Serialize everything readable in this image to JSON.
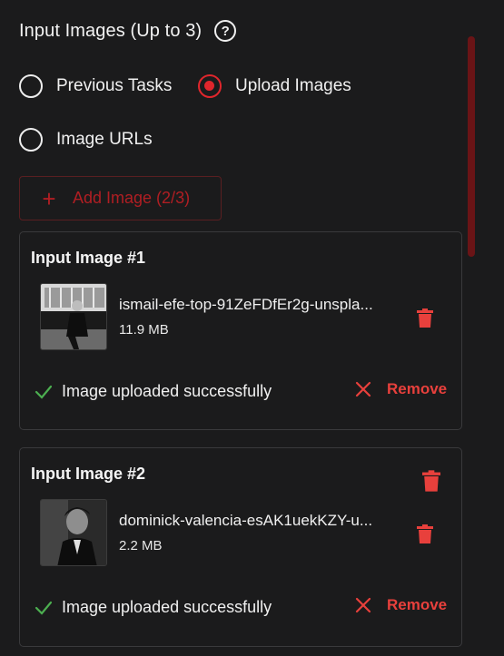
{
  "section": {
    "title": "Input Images (Up to 3)",
    "help_icon": "help-circle-icon"
  },
  "source_options": [
    {
      "label": "Previous Tasks",
      "checked": false
    },
    {
      "label": "Upload Images",
      "checked": true
    },
    {
      "label": "Image URLs",
      "checked": false
    }
  ],
  "add_button": {
    "label": "Add Image (2/3)",
    "icon": "plus-icon"
  },
  "images": [
    {
      "title": "Input Image #1",
      "file_name": "ismail-efe-top-91ZeFDfEr2g-unspla...",
      "file_size": "11.9 MB",
      "status": "Image uploaded successfully",
      "remove_label": "Remove"
    },
    {
      "title": "Input Image #2",
      "file_name": "dominick-valencia-esAK1uekKZY-u...",
      "file_size": "2.2 MB",
      "status": "Image uploaded successfully",
      "remove_label": "Remove"
    }
  ],
  "colors": {
    "accent": "#e0262c",
    "danger": "#e8403c",
    "success": "#4caf50",
    "background": "#1b1b1c"
  }
}
